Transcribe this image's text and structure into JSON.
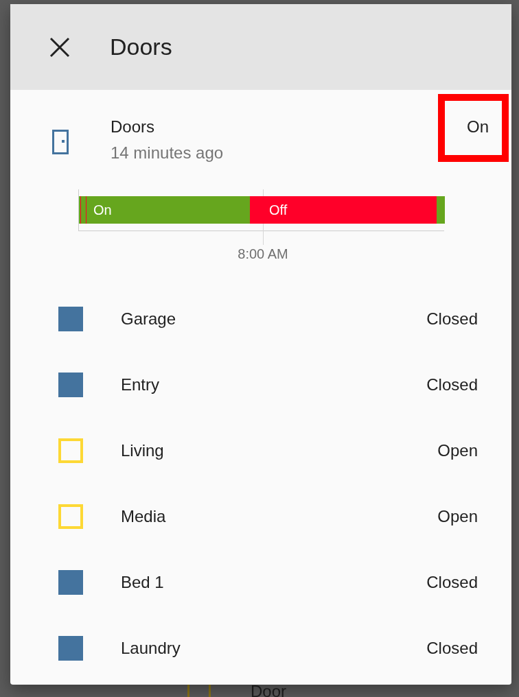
{
  "background": {
    "bottom_label": "Door"
  },
  "dialog": {
    "title": "Doors"
  },
  "entity": {
    "name": "Doors",
    "last_changed": "14 minutes ago",
    "state": "On",
    "highlighted": true
  },
  "timeline": {
    "segments": [
      {
        "kind": "on"
      },
      {
        "kind": "off"
      },
      {
        "kind": "on"
      },
      {
        "kind": "off"
      },
      {
        "kind": "on",
        "label": "On"
      },
      {
        "kind": "off",
        "label": "Off"
      },
      {
        "kind": "on"
      }
    ],
    "axis_label": "8:00 AM"
  },
  "entities": [
    {
      "name": "Garage",
      "state": "Closed",
      "open": false
    },
    {
      "name": "Entry",
      "state": "Closed",
      "open": false
    },
    {
      "name": "Living",
      "state": "Open",
      "open": true
    },
    {
      "name": "Media",
      "state": "Open",
      "open": true
    },
    {
      "name": "Bed 1",
      "state": "Closed",
      "open": false
    },
    {
      "name": "Laundry",
      "state": "Closed",
      "open": false
    }
  ]
}
